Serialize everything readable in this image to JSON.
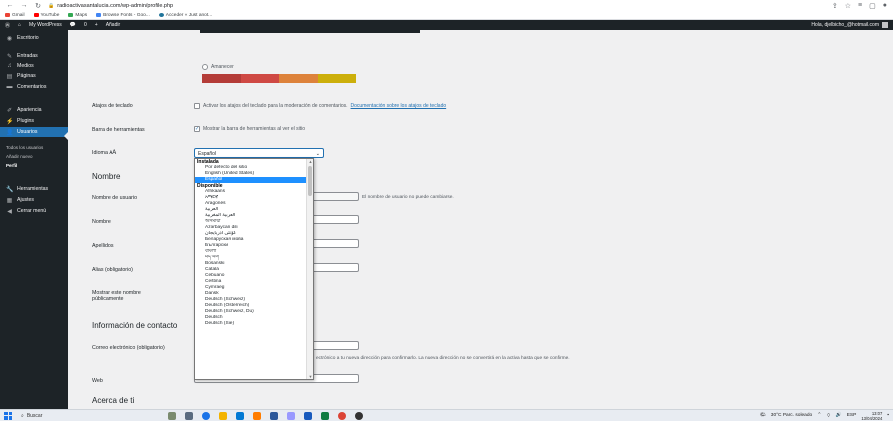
{
  "browser": {
    "url": "radioactivasantalucia.com/wp-admin/profile.php",
    "bookmarks": [
      "Gmail",
      "YouTube",
      "Maps",
      "Browse Fonts - Goo...",
      "Acceder « Just anot..."
    ]
  },
  "adminbar": {
    "site_name": "My WordPress",
    "comments_count": "0",
    "add_new": "Añadir",
    "greeting": "Hola, djelbicho_@hotmail.com"
  },
  "sidebar": {
    "items": [
      {
        "label": "Escritorio"
      },
      {
        "label": "Entradas"
      },
      {
        "label": "Medios"
      },
      {
        "label": "Páginas"
      },
      {
        "label": "Comentarios"
      },
      {
        "label": "Apariencia"
      },
      {
        "label": "Plugins"
      },
      {
        "label": "Usuarios"
      },
      {
        "label": "Herramientas"
      },
      {
        "label": "Ajustes"
      },
      {
        "label": "Cerrar menú"
      }
    ],
    "submenu": [
      "Todos los usuarios",
      "Añadir nuevo",
      "Perfil"
    ]
  },
  "profile": {
    "color_scheme_label": "Amanecer",
    "scheme_colors": [
      "#b43c38",
      "#cf4944",
      "#dd823b",
      "#ccaf0b"
    ],
    "shortcuts_label": "Atajos de teclado",
    "shortcuts_text": "Activar los atajos del teclado para la moderación de comentarios.",
    "shortcuts_link": "Documentación sobre los atajos de teclado",
    "toolbar_label": "Barra de herramientas",
    "toolbar_text": "Mostrar la barra de herramientas al ver el sitio",
    "toolbar_check": "✓",
    "language_label": "Idioma",
    "language_value": "Español",
    "name_heading": "Nombre",
    "username_label": "Nombre de usuario",
    "username_note": "El nombre de usuario no puede cambiarse.",
    "firstname_label": "Nombre",
    "lastname_label": "Apellidos",
    "nickname_label": "Alias (obligatorio)",
    "display_label": "Mostrar este nombre públicamente",
    "contact_heading": "Información de contacto",
    "email_label": "Correo electrónico (obligatorio)",
    "email_note": "ectrónico a tu nueva dirección para confirmarlo. La nueva dirección no se convertirá en la activa hasta que se confirme.",
    "web_label": "Web",
    "about_heading": "Acerca de ti"
  },
  "language_dropdown": {
    "installed_group": "Instalada",
    "installed": [
      "Por defecto del sitio",
      "English (United States)",
      "Español"
    ],
    "selected": "Español",
    "available_group": "Disponible",
    "available": [
      "Afrikaans",
      "አማርኛ",
      "Aragonés",
      "العربية",
      "العربية المغربية",
      "অসমীয়া",
      "Azərbaycan dili",
      "گؤنئی آذربایجان",
      "Беларуская мова",
      "Български",
      "বাংলা",
      "བོད་ཡིག",
      "Bosanski",
      "Català",
      "Cebuano",
      "Čeština",
      "Cymraeg",
      "Dansk",
      "Deutsch (Schweiz)",
      "Deutsch (Österreich)",
      "Deutsch (Schweiz, Du)",
      "Deutsch",
      "Deutsch (Sie)"
    ]
  },
  "taskbar": {
    "search_placeholder": "Buscar",
    "weather": "30°C Parc. soleado",
    "lang": "ESP",
    "time": "13:07",
    "date": "13/04/2024"
  }
}
